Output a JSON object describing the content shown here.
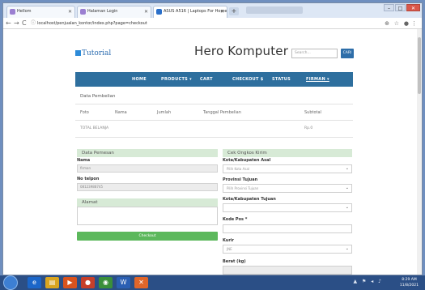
{
  "browser": {
    "tabs": [
      {
        "label": "Hellom",
        "active": false
      },
      {
        "label": "Halaman Login",
        "active": false
      },
      {
        "label": "ASUS A516 | Laptops For Home",
        "active": true
      }
    ],
    "url": "localhost/penjualan_kontor/index.php?page=checkout"
  },
  "site": {
    "logo": "Tutorial",
    "brand": "Hero Komputer",
    "search_placeholder": "Search...",
    "search_button": "CARI"
  },
  "nav": {
    "home": "HOME",
    "products": "PRODUCTS ▾",
    "cart": "CART",
    "checkout": "CHECKOUT $",
    "status": "STATUS",
    "user": "FIRMAN ▾"
  },
  "pembelian": {
    "title": "Data Pembelian",
    "headers": [
      "Foto",
      "Nama",
      "Jumlah",
      "Tanggal Pembelian",
      "Subtotal"
    ],
    "total_label": "TOTAL BELANJA",
    "total_value": "Rp.0"
  },
  "pemesan": {
    "title": "Data Pemesan",
    "nama_label": "Nama",
    "nama_value": "firman",
    "telp_label": "No telpon",
    "telp_value": "08123988745",
    "alamat_title": "Alamat",
    "checkout_button": "Checkout"
  },
  "ongkir": {
    "title": "Cek Ongkos Kirim",
    "kota_asal_label": "Kota/Kabupaten Asal",
    "kota_asal_value": "Pilih Kota Asal",
    "provinsi_label": "Provinsi Tujuan",
    "provinsi_value": "Pilih Provinsi Tujuan",
    "kota_tujuan_label": "Kota/Kabupaten Tujuan",
    "kodepos_label": "Kode Pos *",
    "kurir_label": "Kurir",
    "kurir_value": "JNE",
    "berat_label": "Berat (kg)"
  },
  "taskbar": {
    "time": "8:29 AM",
    "date": "11/8/2021"
  }
}
